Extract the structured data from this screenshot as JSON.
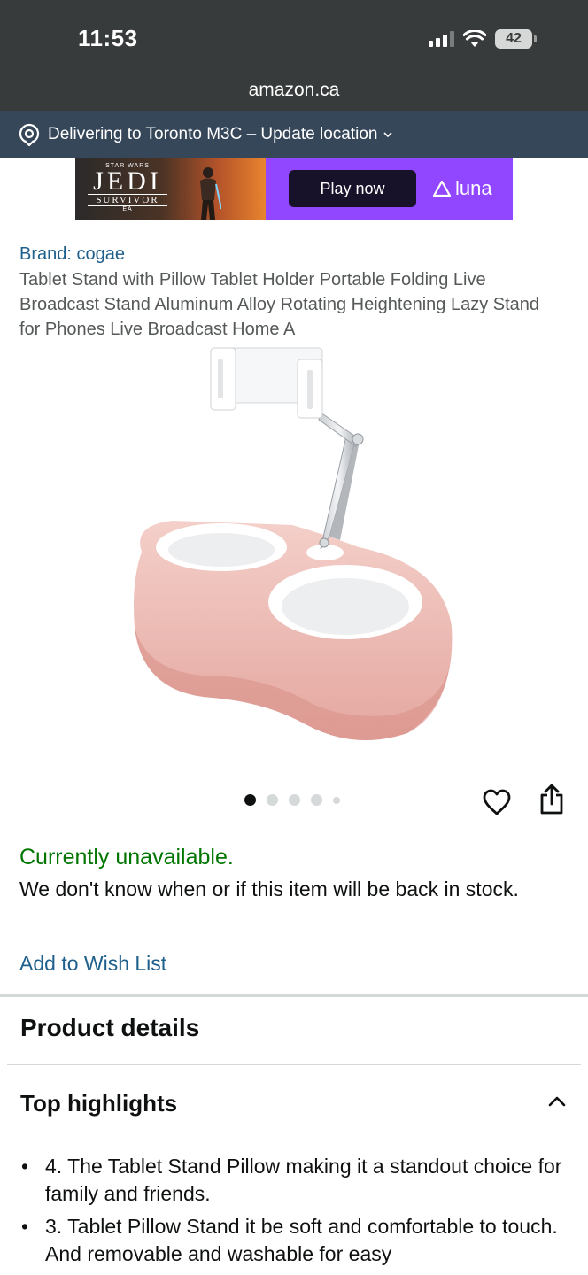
{
  "status_bar": {
    "time": "11:53",
    "battery": "42"
  },
  "browser": {
    "url": "amazon.ca"
  },
  "location": {
    "text": "Delivering to Toronto M3C – Update location"
  },
  "ad": {
    "game_small": "STAR WARS",
    "game_title": "JEDI",
    "game_subtitle": "SURVIVOR",
    "game_publisher": "EA",
    "cta": "Play now",
    "service": "luna"
  },
  "product": {
    "brand": "Brand: cogae",
    "title": "Tablet Stand with Pillow Tablet Holder Portable Folding Live Broadcast Stand Aluminum Alloy Rotating Heightening Lazy Stand for Phones Live Broadcast Home A",
    "image_total": 5,
    "image_current": 1
  },
  "availability": {
    "status": "Currently unavailable.",
    "message": "We don't know when or if this item will be back in stock.",
    "wishlist": "Add to Wish List"
  },
  "details": {
    "title": "Product details",
    "highlights_title": "Top highlights",
    "highlights": [
      "4. The Tablet Stand Pillow making it a standout choice for family and friends.",
      "3. Tablet Pillow Stand it be soft and comfortable to touch. And removable and washable for easy"
    ]
  },
  "colors": {
    "status_bar": "#383b3b",
    "location_bar": "#37475a",
    "link": "#1f5f8c",
    "available_green": "#007600",
    "ad_purple": "#9146ff"
  }
}
